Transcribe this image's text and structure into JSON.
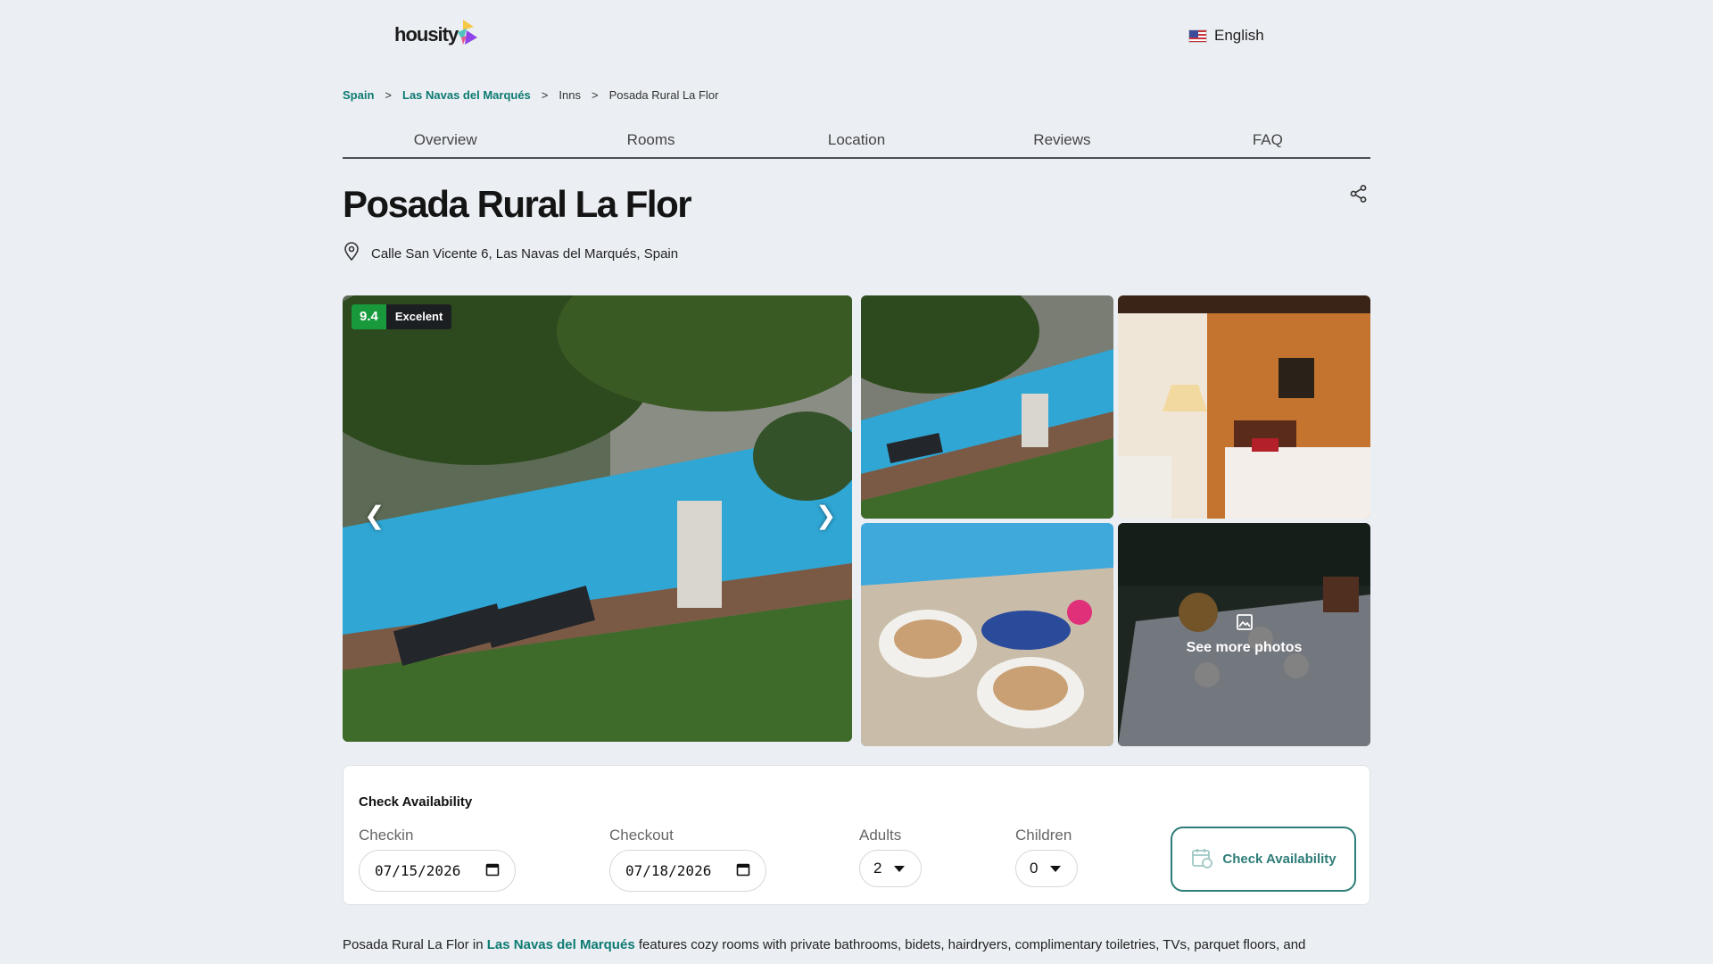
{
  "header": {
    "logo_text": "housity",
    "language": "English"
  },
  "breadcrumb": {
    "items": [
      "Spain",
      "Las Navas del Marqués",
      "Inns",
      "Posada Rural La Flor"
    ],
    "separator": ">"
  },
  "tabs": [
    "Overview",
    "Rooms",
    "Location",
    "Reviews",
    "FAQ"
  ],
  "property": {
    "name": "Posada Rural La Flor",
    "address": "Calle San Vicente 6, Las Navas del Marqués, Spain",
    "rating_score": "9.4",
    "rating_label": "Excelent"
  },
  "gallery": {
    "prev_arrow": "❮",
    "next_arrow": "❯",
    "see_more_label": "See more photos"
  },
  "availability": {
    "heading": "Check Availability",
    "checkin_label": "Checkin",
    "checkin_value": "07/15/2026",
    "checkout_label": "Checkout",
    "checkout_value": "07/18/2026",
    "adults_label": "Adults",
    "adults_value": "2",
    "children_label": "Children",
    "children_value": "0",
    "button_label": "Check Availability"
  },
  "description": {
    "prefix": "Posada Rural La Flor in ",
    "link": "Las Navas del Marqués",
    "suffix": " features cozy rooms with private bathrooms, bidets, hairdryers, complimentary toiletries, TVs, parquet floors, and"
  },
  "colors": {
    "accent": "#0d7a72",
    "rating_green": "#189a3c",
    "background": "#ebeff3"
  }
}
